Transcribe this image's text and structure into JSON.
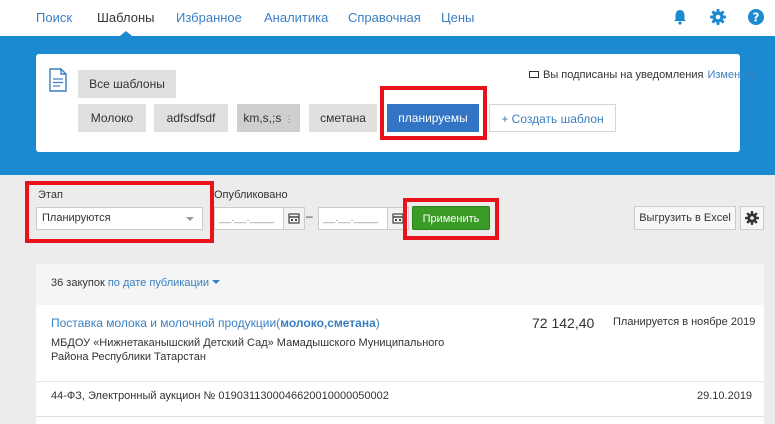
{
  "nav": {
    "items": [
      "Поиск",
      "Шаблоны",
      "Избранное",
      "Аналитика",
      "Справочная",
      "Цены"
    ],
    "active": "Шаблоны"
  },
  "templates": {
    "all_label": "Все шаблоны",
    "chips": [
      "Молоко",
      "adfsdfsdf",
      "km,s,;s",
      "сметана",
      "планируемы"
    ],
    "active_chip": "планируемы",
    "create_label": "+ Создать шаблон",
    "notify_text": "Вы подписаны на уведомления",
    "notify_link": "Изменить"
  },
  "filters": {
    "stage_label": "Этап",
    "stage_value": "Планируются",
    "published_label": "Опубликовано",
    "date_from_placeholder": "__.__.____",
    "date_to_placeholder": "__.__.____",
    "date_sep": "–",
    "apply_label": "Применить",
    "export_label": "Выгрузить в Excel"
  },
  "results": {
    "count_text": "36 закупок",
    "sort_link": "по дате публикации",
    "items": [
      {
        "title_prefix": "Поставка молока и молочной продукции(",
        "title_keywords": "молоко,сметана",
        "title_suffix": ")",
        "org": "МБДОУ «Нижнетаканышский Детский Сад» Мамадышского Муниципального Района Республики Татарстан",
        "price": "72 142,40",
        "plan": "Планируется в ноябре 2019",
        "law": "44-ФЗ, Электронный аукцион № 0190311300046620010000050002",
        "date": "29.10.2019"
      }
    ]
  },
  "colors": {
    "accent": "#1c8ad0",
    "link": "#3a7fc1",
    "active_chip": "#3175c4",
    "apply": "#3a9b26",
    "highlight": "#e8121a"
  },
  "icons": [
    "bell-icon",
    "gear-icon",
    "help-icon",
    "document-icon",
    "mail-icon",
    "calendar-icon",
    "chevron-down-icon"
  ]
}
